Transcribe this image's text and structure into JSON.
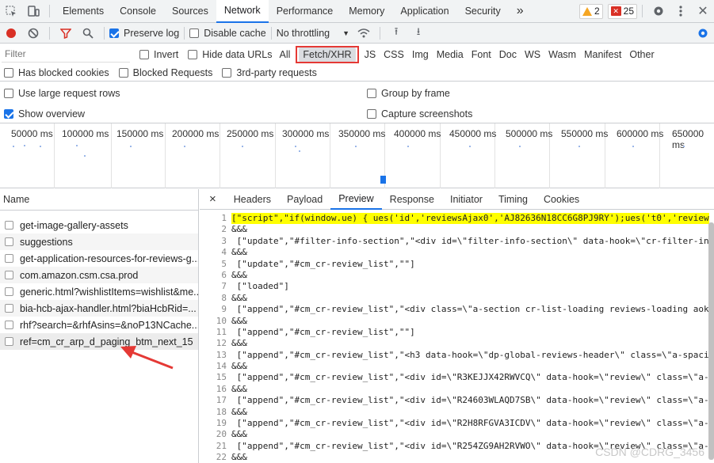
{
  "toolbar": {
    "tabs": [
      "Elements",
      "Console",
      "Sources",
      "Network",
      "Performance",
      "Memory",
      "Application",
      "Security"
    ],
    "more": "»",
    "warnings": "2",
    "errors": "25"
  },
  "net_toolbar": {
    "preserve_log": "Preserve log",
    "disable_cache": "Disable cache",
    "throttling": "No throttling"
  },
  "filter": {
    "placeholder": "Filter",
    "invert": "Invert",
    "hide_data_urls": "Hide data URLs",
    "types": [
      "All",
      "Fetch/XHR",
      "JS",
      "CSS",
      "Img",
      "Media",
      "Font",
      "Doc",
      "WS",
      "Wasm",
      "Manifest",
      "Other"
    ],
    "has_blocked_cookies": "Has blocked cookies",
    "blocked_requests": "Blocked Requests",
    "third_party": "3rd-party requests"
  },
  "options": {
    "large_rows": "Use large request rows",
    "group_by_frame": "Group by frame",
    "show_overview": "Show overview",
    "capture_screenshots": "Capture screenshots"
  },
  "overview": {
    "ticks": [
      "50000 ms",
      "100000 ms",
      "150000 ms",
      "200000 ms",
      "250000 ms",
      "300000 ms",
      "350000 ms",
      "400000 ms",
      "450000 ms",
      "500000 ms",
      "550000 ms",
      "600000 ms",
      "650000 ms"
    ]
  },
  "requests": {
    "header": "Name",
    "items": [
      "get-image-gallery-assets",
      "suggestions",
      "get-application-resources-for-reviews-g...",
      "com.amazon.csm.csa.prod",
      "generic.html?wishlistItems=wishlist&me...",
      "bia-hcb-ajax-handler.html?biaHcbRid=...",
      "rhf?search=&rhfAsins=&noP13NCache...",
      "ref=cm_cr_arp_d_paging_btm_next_15"
    ]
  },
  "detail": {
    "close": "×",
    "tabs": [
      "Headers",
      "Payload",
      "Preview",
      "Response",
      "Initiator",
      "Timing",
      "Cookies"
    ],
    "lines": [
      {
        "n": "1",
        "t": "[\"script\",\"if(window.ue) { ues('id','reviewsAjax0','AJ82636N18CC6G8PJ9RY');ues('t0','review"
      },
      {
        "n": "2",
        "t": "&&&"
      },
      {
        "n": "3",
        "t": " [\"update\",\"#filter-info-section\",\"<div id=\\\"filter-info-section\\\" data-hook=\\\"cr-filter-in"
      },
      {
        "n": "4",
        "t": "&&&"
      },
      {
        "n": "5",
        "t": " [\"update\",\"#cm_cr-review_list\",\"\"]"
      },
      {
        "n": "6",
        "t": "&&&"
      },
      {
        "n": "7",
        "t": " [\"loaded\"]"
      },
      {
        "n": "8",
        "t": "&&&"
      },
      {
        "n": "9",
        "t": " [\"append\",\"#cm_cr-review_list\",\"<div class=\\\"a-section cr-list-loading reviews-loading aok"
      },
      {
        "n": "10",
        "t": "&&&"
      },
      {
        "n": "11",
        "t": " [\"append\",\"#cm_cr-review_list\",\"\"]"
      },
      {
        "n": "12",
        "t": "&&&"
      },
      {
        "n": "13",
        "t": " [\"append\",\"#cm_cr-review_list\",\"<h3 data-hook=\\\"dp-global-reviews-header\\\" class=\\\"a-spaci"
      },
      {
        "n": "14",
        "t": "&&&"
      },
      {
        "n": "15",
        "t": " [\"append\",\"#cm_cr-review_list\",\"<div id=\\\"R3KEJJX42RWVCQ\\\" data-hook=\\\"review\\\" class=\\\"a-"
      },
      {
        "n": "16",
        "t": "&&&"
      },
      {
        "n": "17",
        "t": " [\"append\",\"#cm_cr-review_list\",\"<div id=\\\"R24603WLAQD7SB\\\" data-hook=\\\"review\\\" class=\\\"a-"
      },
      {
        "n": "18",
        "t": "&&&"
      },
      {
        "n": "19",
        "t": " [\"append\",\"#cm_cr-review_list\",\"<div id=\\\"R2H8RFGVA3ICDV\\\" data-hook=\\\"review\\\" class=\\\"a-"
      },
      {
        "n": "20",
        "t": "&&&"
      },
      {
        "n": "21",
        "t": " [\"append\",\"#cm_cr-review_list\",\"<div id=\\\"R254ZG9AH2RVWO\\\" data-hook=\\\"review\\\" class=\\\"a-"
      },
      {
        "n": "22",
        "t": "&&&"
      }
    ]
  },
  "watermark": "CSDN @CDRG_3456",
  "colors": {
    "accent": "#1a73e8",
    "highlight_box": "#e53935",
    "arrow": "#e53935",
    "hl": "#ffff00"
  }
}
